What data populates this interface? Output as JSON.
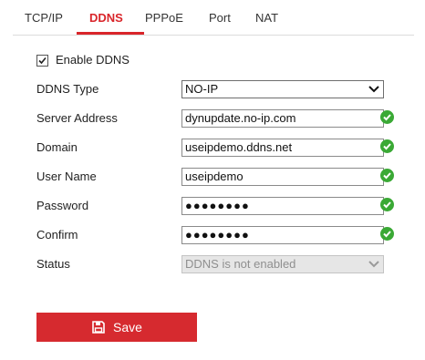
{
  "tabs": [
    {
      "label": "TCP/IP",
      "active": false
    },
    {
      "label": "DDNS",
      "active": true
    },
    {
      "label": "PPPoE",
      "active": false
    },
    {
      "label": "Port",
      "active": false
    },
    {
      "label": "NAT",
      "active": false
    }
  ],
  "enable_ddns": {
    "label": "Enable DDNS",
    "checked": true
  },
  "form": {
    "ddns_type": {
      "label": "DDNS Type",
      "value": "NO-IP"
    },
    "server_address": {
      "label": "Server Address",
      "value": "dynupdate.no-ip.com",
      "valid": true
    },
    "domain": {
      "label": "Domain",
      "value": "useipdemo.ddns.net",
      "valid": true
    },
    "user_name": {
      "label": "User Name",
      "value": "useipdemo",
      "valid": true
    },
    "password": {
      "label": "Password",
      "value": "●●●●●●●●",
      "valid": true
    },
    "confirm": {
      "label": "Confirm",
      "value": "●●●●●●●●",
      "valid": true
    },
    "status": {
      "label": "Status",
      "value": "DDNS is not enabled",
      "disabled": true
    }
  },
  "save_button": {
    "label": "Save"
  },
  "colors": {
    "accent": "#d9252a",
    "save_button": "#d62a2f",
    "valid_check": "#3aa935"
  },
  "icons": {
    "valid": "check-circle-icon",
    "dropdown": "chevron-down-icon",
    "save": "floppy-disk-icon",
    "checkbox": "checkbox-checked-icon"
  }
}
